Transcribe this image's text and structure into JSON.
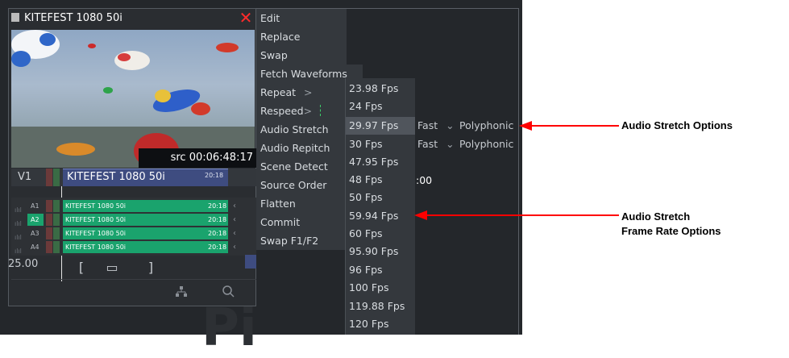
{
  "clip": {
    "title": "KITEFEST 1080 50i",
    "source_timecode": "src 00:06:48:17",
    "fps": "25.00",
    "video_track": {
      "label": "V1",
      "clip_name": "KITEFEST 1080 50i",
      "duration": "20:18"
    },
    "audio_tracks": [
      {
        "label": "A1",
        "clip_name": "KITEFEST 1080 50i",
        "duration": "20:18"
      },
      {
        "label": "A2",
        "clip_name": "KITEFEST 1080 50i",
        "duration": "20:18"
      },
      {
        "label": "A3",
        "clip_name": "KITEFEST 1080 50i",
        "duration": "20:18"
      },
      {
        "label": "A4",
        "clip_name": "KITEFEST 1080 50i",
        "duration": "20:18"
      }
    ],
    "controls": {
      "mark_in": "[",
      "mark_clip": "▭",
      "mark_out": "]"
    }
  },
  "context_menu": [
    {
      "label": "Edit"
    },
    {
      "label": "Replace"
    },
    {
      "label": "Swap"
    },
    {
      "label": "Fetch Waveforms"
    },
    {
      "label": "Repeat",
      "arrow": ">"
    },
    {
      "label": "Respeed",
      "arrow": ">"
    },
    {
      "label": "Audio Stretch"
    },
    {
      "label": "Audio Repitch"
    },
    {
      "label": "Scene Detect"
    },
    {
      "label": "Source Order"
    },
    {
      "label": "Flatten"
    },
    {
      "label": "Commit"
    },
    {
      "label": "Swap F1/F2"
    }
  ],
  "fps_submenu": [
    "23.98 Fps",
    "24 Fps",
    "29.97 Fps",
    "30 Fps",
    "47.95 Fps",
    "48 Fps",
    "50 Fps",
    "59.94 Fps",
    "60 Fps",
    "95.90 Fps",
    "96 Fps",
    "100 Fps",
    "119.88 Fps",
    "120 Fps"
  ],
  "fps_highlighted": "29.97 Fps",
  "stretch_options": {
    "speed": "Fast",
    "mode": "Polyphonic"
  },
  "repitch_options": {
    "speed": "Fast",
    "mode": "Polyphonic"
  },
  "partial_timecode": ":00",
  "annotations": {
    "stretch_options": "Audio Stretch Options",
    "frame_rate_line1": "Audio Stretch",
    "frame_rate_line2": "Frame Rate Options"
  },
  "colors": {
    "accent_blue": "#3e4c80",
    "audio_green": "#1aa36d",
    "close_red": "#ff2b2b",
    "arrow_red": "#ff0000"
  }
}
